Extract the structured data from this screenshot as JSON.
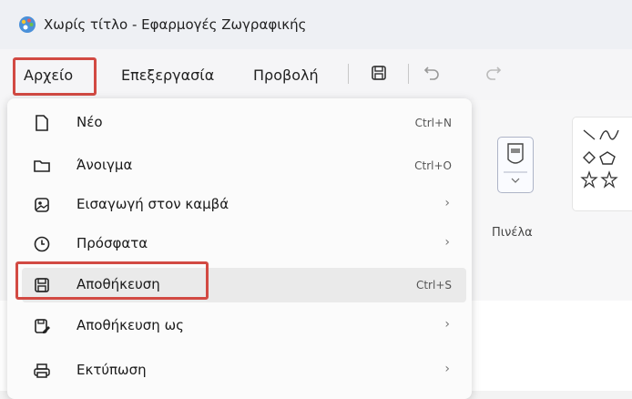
{
  "window": {
    "title": "Χωρίς τίτλο - Εφαρμογές Ζωγραφικής"
  },
  "menubar": {
    "file": "Αρχείο",
    "edit": "Επεξεργασία",
    "view": "Προβολή"
  },
  "ribbon": {
    "brush_label": "Πινέλα"
  },
  "file_menu": {
    "items": [
      {
        "label": "Νέο",
        "shortcut": "Ctrl+N",
        "icon": "new-file-icon"
      },
      {
        "label": "Άνοιγμα",
        "shortcut": "Ctrl+O",
        "icon": "folder-icon"
      },
      {
        "label": "Εισαγωγή στον καμβά",
        "submenu": "›",
        "icon": "import-image-icon"
      },
      {
        "label": "Πρόσφατα",
        "submenu": "›",
        "icon": "clock-icon"
      },
      {
        "label": "Αποθήκευση",
        "shortcut": "Ctrl+S",
        "icon": "save-icon"
      },
      {
        "label": "Αποθήκευση ως",
        "submenu": "›",
        "icon": "save-as-icon"
      },
      {
        "label": "Εκτύπωση",
        "submenu": "›",
        "icon": "print-icon"
      }
    ]
  },
  "colors": {
    "highlight_outline": "#d24a43",
    "menu_bg": "#fbfbfb"
  }
}
